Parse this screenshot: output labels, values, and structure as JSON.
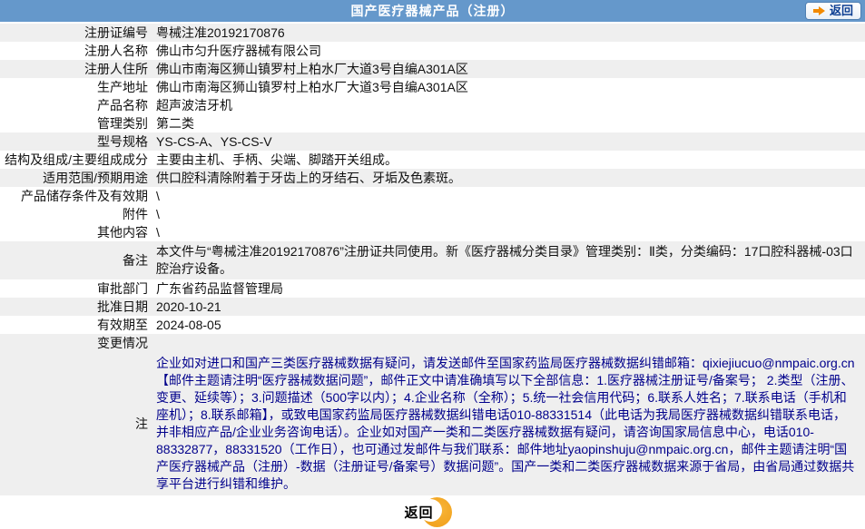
{
  "header": {
    "title": "国产医疗器械产品（注册）",
    "back_label": "返回",
    "back_icon": "arrow-right-icon"
  },
  "table": {
    "rows": [
      {
        "label": "注册证编号",
        "value": "粤械注准20192170876",
        "shaded": true
      },
      {
        "label": "注册人名称",
        "value": "佛山市匀升医疗器械有限公司",
        "shaded": false
      },
      {
        "label": "注册人住所",
        "value": "佛山市南海区狮山镇罗村上柏水厂大道3号自编A301A区",
        "shaded": true
      },
      {
        "label": "生产地址",
        "value": "佛山市南海区狮山镇罗村上柏水厂大道3号自编A301A区",
        "shaded": false
      },
      {
        "label": "产品名称",
        "value": "超声波洁牙机",
        "shaded": false
      },
      {
        "label": "管理类别",
        "value": "第二类",
        "shaded": false
      },
      {
        "label": "型号规格",
        "value": "YS-CS-A、YS-CS-V",
        "shaded": true
      },
      {
        "label": "结构及组成/主要组成成分",
        "value": "主要由主机、手柄、尖端、脚踏开关组成。",
        "shaded": false
      },
      {
        "label": "适用范围/预期用途",
        "value": "供口腔科清除附着于牙齿上的牙结石、牙垢及色素斑。",
        "shaded": true
      },
      {
        "label": "产品储存条件及有效期",
        "value": "\\",
        "shaded": false
      },
      {
        "label": "附件",
        "value": "\\",
        "shaded": false
      },
      {
        "label": "其他内容",
        "value": "\\",
        "shaded": false
      },
      {
        "label": "备注",
        "value": "本文件与“粤械注准20192170876”注册证共同使用。新《医疗器械分类目录》管理类别：Ⅱ类，分类编码：17口腔科器械-03口腔治疗设备。",
        "shaded": true,
        "multiline": true
      },
      {
        "label": "审批部门",
        "value": "广东省药品监督管理局",
        "shaded": false
      },
      {
        "label": "批准日期",
        "value": "2020-10-21",
        "shaded": true
      },
      {
        "label": "有效期至",
        "value": "2024-08-05",
        "shaded": false
      },
      {
        "label": "变更情况",
        "value": "",
        "shaded": true
      },
      {
        "label": "注",
        "value": "企业如对进口和国产三类医疗器械数据有疑问，请发送邮件至国家药监局医疗器械数据纠错邮箱：qixiejiucuo@nmpaic.org.cn【邮件主题请注明“医疗器械数据问题”，邮件正文中请准确填写以下全部信息：1.医疗器械注册证号/备案号； 2.类型（注册、变更、延续等）；3.问题描述（500字以内）；4.企业名称（全称）；5.统一社会信用代码；6.联系人姓名；7.联系电话（手机和座机）；8.联系邮箱】，或致电国家药监局医疗器械数据纠错电话010-88331514（此电话为我局医疗器械数据纠错联系电话，并非相应产品/企业业务咨询电话）。企业如对国产一类和二类医疗器械数据有疑问，请咨询国家局信息中心，电话010-88332877，88331520（工作日），也可通过发邮件与我们联系：邮件地址yaopinshuju@nmpaic.org.cn，邮件主题请注明“国产医疗器械产品（注册）-数据（注册证号/备案号）数据问题”。国产一类和二类医疗器械数据来源于省局，由省局通过数据共享平台进行纠错和维护。",
        "shaded": true,
        "note": true
      }
    ]
  },
  "footer": {
    "back_label": "返回"
  },
  "colors": {
    "header_bg": "#6598cb",
    "row_shaded": "#efefef",
    "note_text": "#00008b",
    "accent_orange": "#f2a31f"
  }
}
